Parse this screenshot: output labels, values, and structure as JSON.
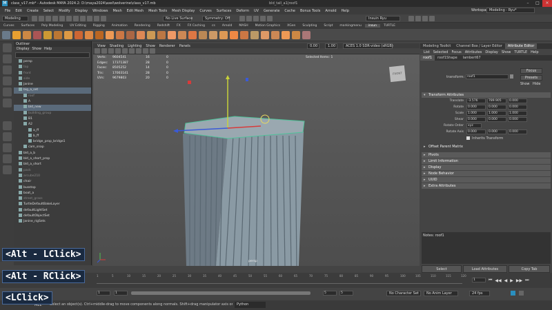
{
  "window": {
    "title": "class_v17.mb* - Autodesk MAYA 2024.2: D:\\maya2024\\axel\\wolverine\\class_v17.mb",
    "center": "bld_tall_a1|roof1",
    "workspace_label": "Workspace :",
    "workspace": "Modeling - Ryu*"
  },
  "menus": [
    "File",
    "Edit",
    "Create",
    "Select",
    "Modify",
    "Display",
    "Windows",
    "Mesh",
    "Edit Mesh",
    "Mesh Tools",
    "Mesh Display",
    "Curves",
    "Surfaces",
    "Deform",
    "UV",
    "Generate",
    "Cache",
    "Bonus Tools",
    "Arnold",
    "Help"
  ],
  "statusline": {
    "mode": "Modeling",
    "live_surface": "No Live Surface",
    "symmetry": "Symmetry: Off",
    "user": "Insuin Ryu"
  },
  "shelf_tabs": [
    "Curves",
    "Surfaces",
    "Poly Modeling",
    "UV Editing",
    "Rigging",
    "Animation",
    "Rendering",
    "Redshift",
    "FX",
    "FX Caching",
    "cs",
    "Arnold",
    "MASH",
    "Motion Graphics",
    "XGen",
    "Sculpting",
    "Script",
    "markingmenu",
    "insun",
    "TURTLE"
  ],
  "shelf_active": "insun",
  "outliner": {
    "title": "Outliner",
    "menu": [
      "Display",
      "Show",
      "Help"
    ],
    "items": [
      {
        "label": "persp",
        "indent": 1,
        "dim": false,
        "sel": false
      },
      {
        "label": "top",
        "indent": 1,
        "dim": true,
        "sel": false
      },
      {
        "label": "front",
        "indent": 1,
        "dim": true,
        "sel": false
      },
      {
        "label": "side",
        "indent": 1,
        "dim": true,
        "sel": false
      },
      {
        "label": "Janine",
        "indent": 1,
        "dim": false,
        "sel": false
      },
      {
        "label": "big_a_set",
        "indent": 1,
        "dim": false,
        "sel": true
      },
      {
        "label": "roof",
        "indent": 2,
        "dim": true,
        "sel": false
      },
      {
        "label": "A",
        "indent": 2,
        "dim": false,
        "sel": false
      },
      {
        "label": "bld_new",
        "indent": 2,
        "dim": false,
        "sel": true
      },
      {
        "label": "building_group",
        "indent": 2,
        "dim": true,
        "sel": false
      },
      {
        "label": "B1",
        "indent": 2,
        "dim": false,
        "sel": false
      },
      {
        "label": "A2",
        "indent": 2,
        "dim": false,
        "sel": false
      },
      {
        "label": "a_ff",
        "indent": 3,
        "dim": false,
        "sel": false
      },
      {
        "label": "b_ff",
        "indent": 3,
        "dim": false,
        "sel": false
      },
      {
        "label": "bridge_prop_bridge1",
        "indent": 3,
        "dim": false,
        "sel": false
      },
      {
        "label": "cam_snap",
        "indent": 2,
        "dim": false,
        "sel": false
      },
      {
        "label": "bld_a_b",
        "indent": 1,
        "dim": false,
        "sel": false
      },
      {
        "label": "bld_a_short_prop",
        "indent": 1,
        "dim": false,
        "sel": false
      },
      {
        "label": "bld_a_short",
        "indent": 1,
        "dim": false,
        "sel": false
      },
      {
        "label": "pack",
        "indent": 1,
        "dim": true,
        "sel": false
      },
      {
        "label": "arcube210",
        "indent": 1,
        "dim": true,
        "sel": false
      },
      {
        "label": "chair",
        "indent": 1,
        "dim": false,
        "sel": false
      },
      {
        "label": "busstop",
        "indent": 1,
        "dim": false,
        "sel": false
      },
      {
        "label": "boat_a",
        "indent": 1,
        "dim": false,
        "sel": false
      },
      {
        "label": "street_grass",
        "indent": 1,
        "dim": true,
        "sel": false
      },
      {
        "label": "TurtleDefaultBakeLayer",
        "indent": 1,
        "dim": false,
        "sel": false
      },
      {
        "label": "defaultLightSet",
        "indent": 1,
        "dim": false,
        "sel": false
      },
      {
        "label": "defaultObjectSet",
        "indent": 1,
        "dim": false,
        "sel": false
      },
      {
        "label": "Janine_rigSets",
        "indent": 1,
        "dim": false,
        "sel": false
      }
    ]
  },
  "viewport": {
    "menu": [
      "View",
      "Shading",
      "Lighting",
      "Show",
      "Renderer",
      "Panels"
    ],
    "exposure": "0.00",
    "gamma": "1.00",
    "colorspace": "ACES 1.0 SDR-video (sRGB)",
    "hud": [
      {
        "k": "Verts:",
        "v1": "9604541",
        "v2": "16",
        "v3": "0"
      },
      {
        "k": "Edges:",
        "v1": "17371387",
        "v2": "28",
        "v3": "0"
      },
      {
        "k": "Faces:",
        "v1": "8505252",
        "v2": "14",
        "v3": "0"
      },
      {
        "k": "Tris:",
        "v1": "17003141",
        "v2": "28",
        "v3": "0"
      },
      {
        "k": "UVs:",
        "v1": "9679803",
        "v2": "20",
        "v3": "0"
      }
    ],
    "selected_items": "Selected Items: 1",
    "camera": "persp",
    "viewcube_label": "FRONT"
  },
  "attr": {
    "panel_tabs": [
      "Modeling Toolkit",
      "Channel Box / Layer Editor",
      "Attribute Editor"
    ],
    "menu": [
      "List",
      "Selected",
      "Focus",
      "Attributes",
      "Display",
      "Show",
      "TURTLE",
      "Help"
    ],
    "node_tabs": [
      "roof1",
      "roof1Shape",
      "lambert67"
    ],
    "transform_label": "transform:",
    "transform_value": "roof1",
    "buttons": {
      "focus": "Focus",
      "presets": "Presets",
      "show": "Show",
      "hide": "Hide"
    },
    "section_open": "Transform Attributes",
    "rows": [
      {
        "label": "Translate",
        "v": [
          "-3.576",
          "789.905",
          "0.000"
        ]
      },
      {
        "label": "Rotate",
        "v": [
          "0.000",
          "0.000",
          "0.000"
        ]
      },
      {
        "label": "Scale",
        "v": [
          "1.000",
          "1.000",
          "1.000"
        ]
      },
      {
        "label": "Shear",
        "v": [
          "0.000",
          "0.000",
          "0.000"
        ]
      }
    ],
    "rotate_order_label": "Rotate Order",
    "rotate_order": "xyz",
    "rotate_axis_label": "Rotate Axis",
    "rotate_axis": [
      "0.000",
      "0.000",
      "0.000"
    ],
    "inherits": "Inherits Transform",
    "sections": [
      "Offset Parent Matrix",
      "Pivots",
      "Limit Information",
      "Display",
      "Node Behavior",
      "UUID",
      "Extra Attributes"
    ],
    "notes": "Notes: roof1",
    "bottom": [
      "Select",
      "Load Attributes",
      "Copy Tab"
    ]
  },
  "timeline": {
    "ticks": [
      "1",
      "5",
      "10",
      "15",
      "20",
      "25",
      "30",
      "35",
      "40",
      "45",
      "50",
      "55",
      "60",
      "65",
      "70",
      "75",
      "80",
      "85",
      "90",
      "95",
      "100",
      "105",
      "110",
      "115",
      "120"
    ],
    "current": "1"
  },
  "range": {
    "start": "1",
    "start2": "1",
    "end": "5",
    "end2": "5",
    "character": "No Character Set",
    "anim_layer": "No Anim Layer",
    "fps": "24 fps"
  },
  "cmdline": {
    "mel": "MEL",
    "help": "Select an object(s). Ctrl+middle-drag to move components along normals. Shift+drag manipulator axis or plane handles to extrude components or clone objects.",
    "lang": "Python"
  },
  "overlays": [
    "<Alt - LClick>",
    "<Alt - RClick>",
    "<LClick>"
  ],
  "colors": {
    "select": "#5a6a7a",
    "accent": "#4a6a9a",
    "highlight": "#4fc39a"
  }
}
